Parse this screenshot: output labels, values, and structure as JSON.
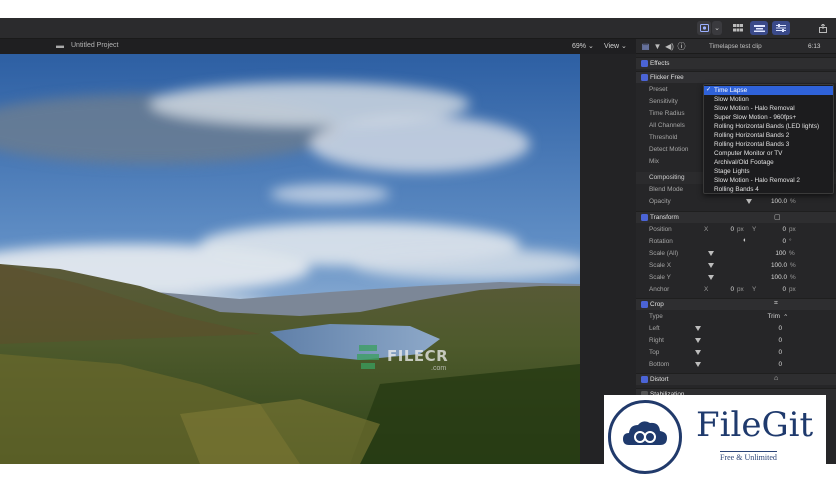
{
  "toolbar": {
    "icons": [
      "media-browser-icon",
      "chevron-down-icon",
      "browser-grid-icon",
      "timeline-icon",
      "inspector-icon",
      "share-icon"
    ]
  },
  "viewer": {
    "project_title": "Untitled Project",
    "zoom": "69%",
    "view_menu": "View"
  },
  "inspector": {
    "clip_name": "Timelapse test clip",
    "timecode": "6:13",
    "effects_label": "Effects",
    "flicker": {
      "label": "Flicker Free",
      "rows": [
        "Preset",
        "Sensitivity",
        "Time Radius",
        "All Channels",
        "Threshold",
        "Detect Motion",
        "Mix"
      ]
    },
    "compositing": {
      "label": "Compositing",
      "blend_mode": "Blend Mode",
      "opacity_label": "Opacity",
      "opacity_value": "100.0",
      "opacity_unit": "%"
    },
    "transform": {
      "label": "Transform",
      "position_label": "Position",
      "position_x_axis": "X",
      "position_x": "0",
      "position_y_axis": "Y",
      "position_y": "0",
      "px": "px",
      "rotation_label": "Rotation",
      "rotation_value": "0",
      "degree": "°",
      "scale_all_label": "Scale (All)",
      "scale_all": "100",
      "scale_x_label": "Scale X",
      "scale_x": "100.0",
      "scale_y_label": "Scale Y",
      "scale_y": "100.0",
      "pct": "%",
      "anchor_label": "Anchor",
      "anchor_x": "0",
      "anchor_y": "0"
    },
    "crop": {
      "label": "Crop",
      "type_label": "Type",
      "type_value": "Trim",
      "left_label": "Left",
      "right_label": "Right",
      "top_label": "Top",
      "bottom_label": "Bottom",
      "left": "0",
      "right": "0",
      "top": "0",
      "bottom": "0"
    },
    "distort": {
      "label": "Distort"
    },
    "stabilization": {
      "label": "Stabilization"
    }
  },
  "preset_menu": {
    "selected": "Time Lapse",
    "items": [
      "Time Lapse",
      "Slow Motion",
      "Slow Motion - Halo Removal",
      "Super Slow Motion - 960fps+",
      "Rolling Horizontal Bands (LED lights)",
      "Rolling Horizontal Bands 2",
      "Rolling Horizontal Bands 3",
      "Computer Monitor or TV",
      "Archival/Old Footage",
      "Stage Lights",
      "Slow Motion - Halo Removal 2",
      "Rolling Bands 4"
    ]
  },
  "watermarks": {
    "filecr": "FILECR",
    "filecr_sub": ".com",
    "filegit": "FileGit",
    "filegit_sub": "Free & Unlimited"
  },
  "colors": {
    "accent": "#2f62d9",
    "checkbox": "#4b64d6",
    "panel": "#262628",
    "brand_filegit": "#1f3a6d"
  }
}
